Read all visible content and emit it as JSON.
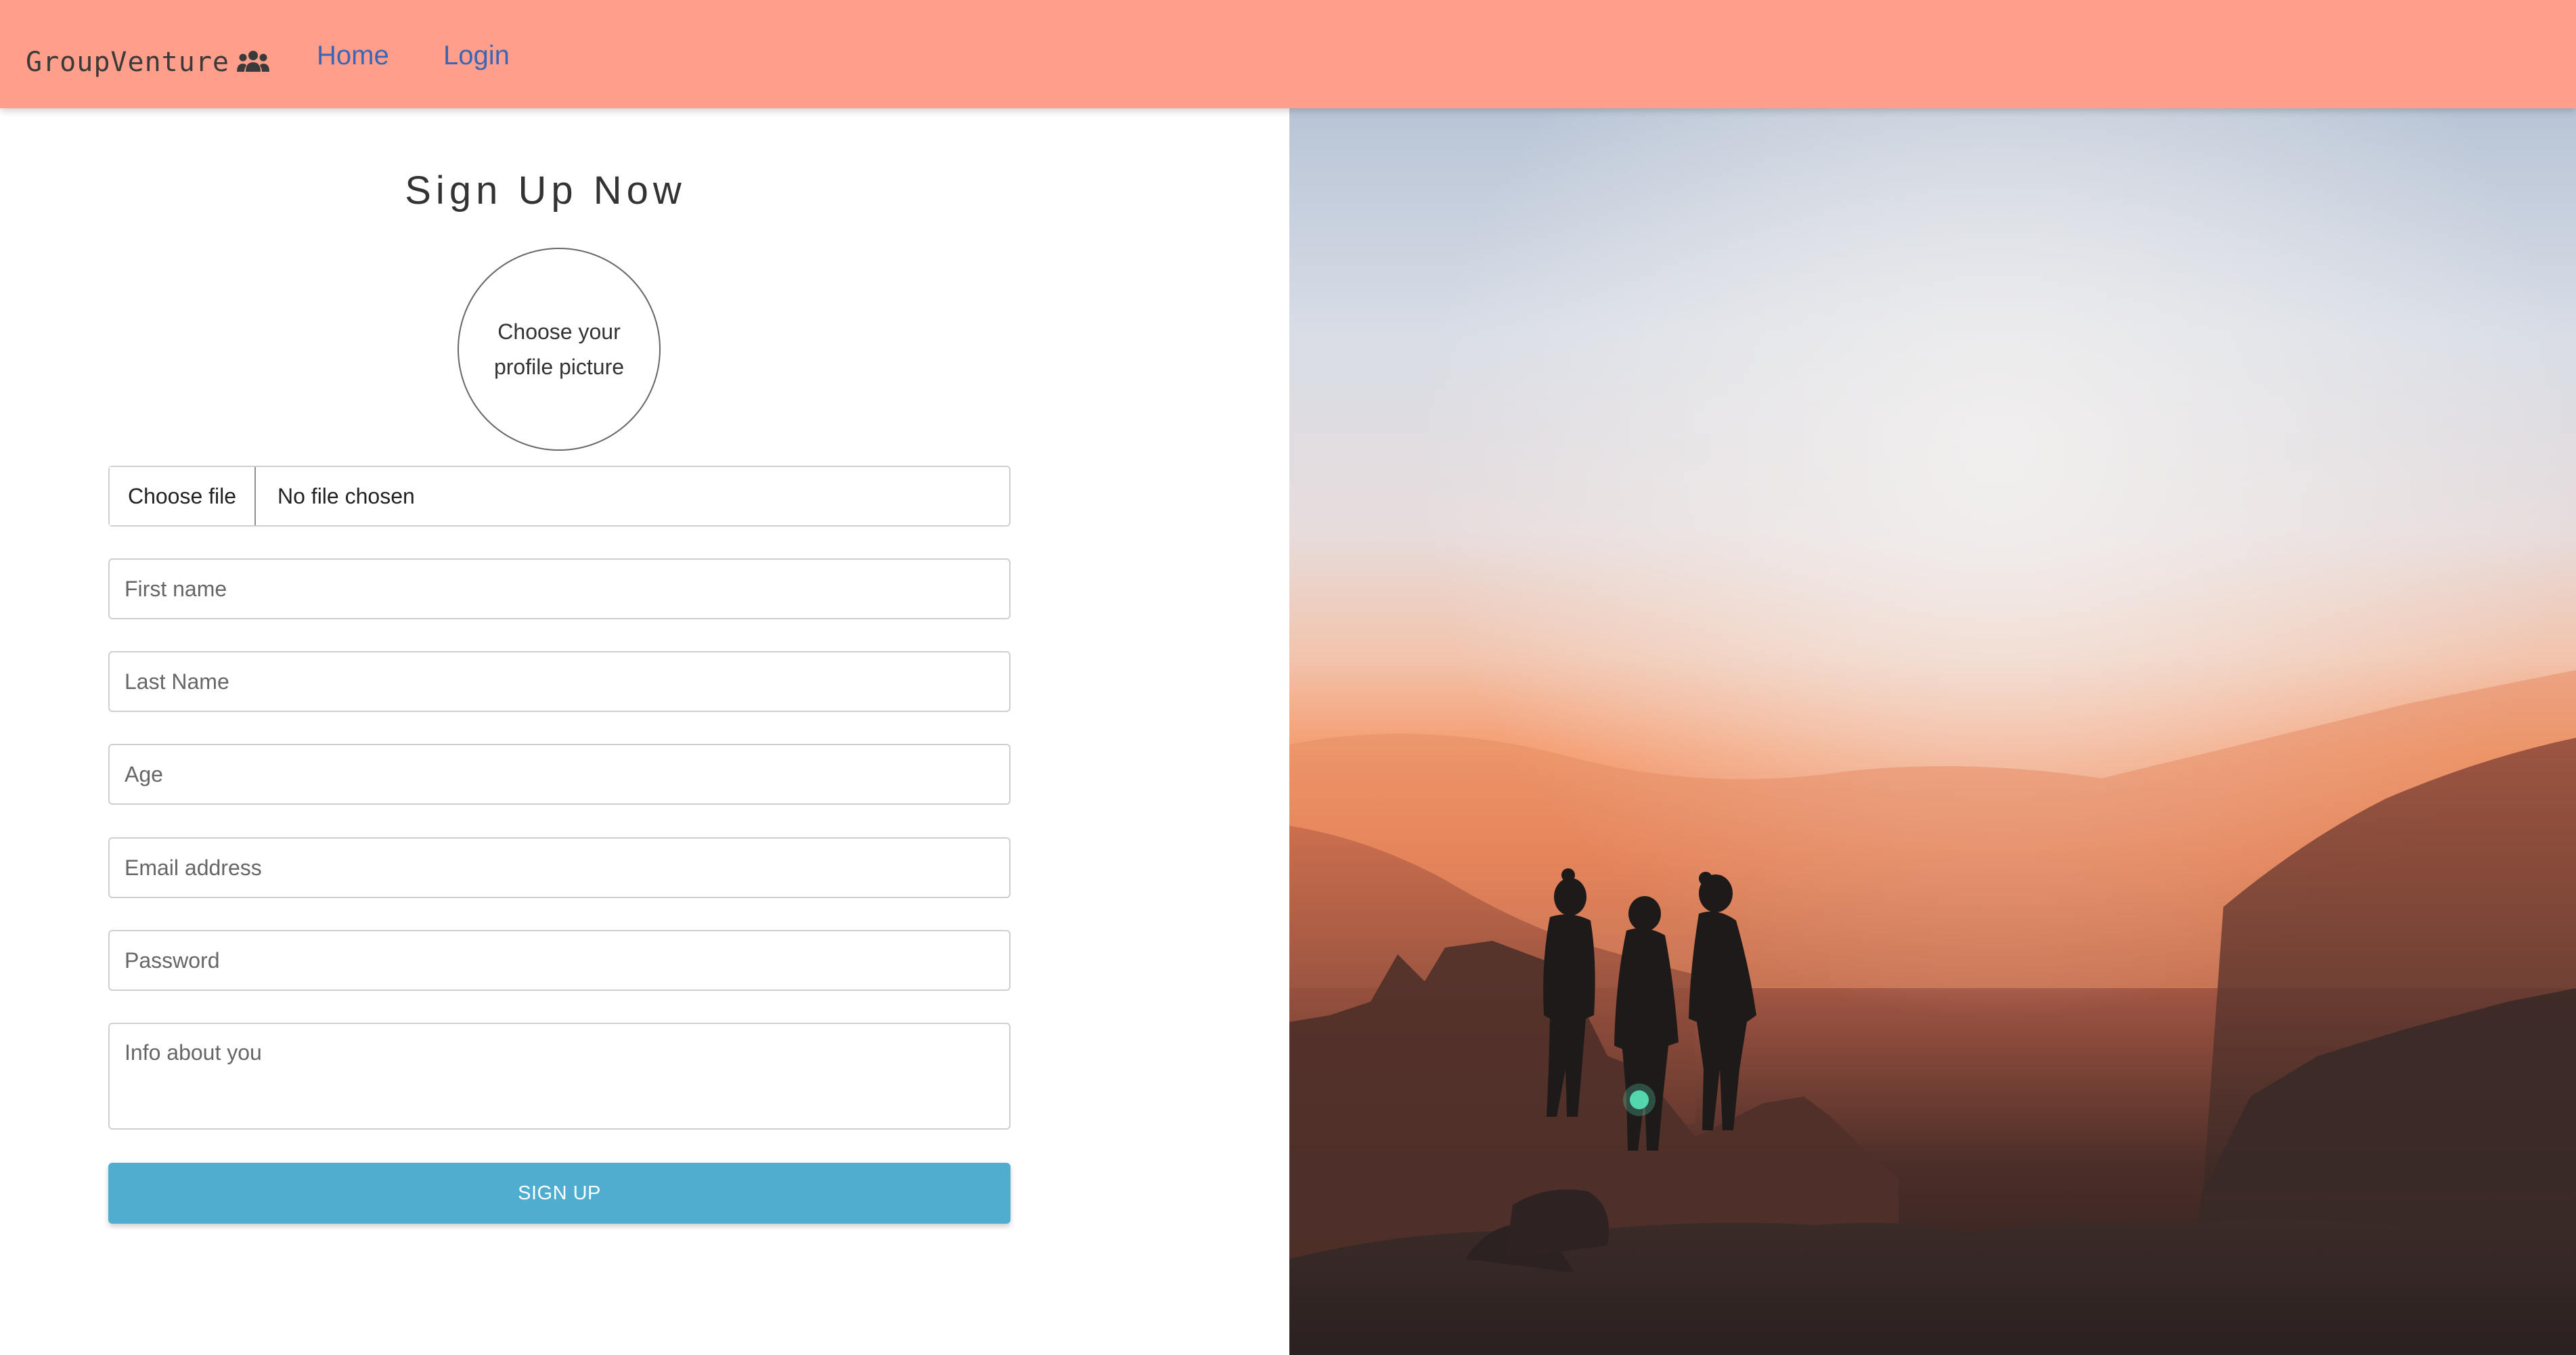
{
  "navbar": {
    "brand": "GroupVenture",
    "brand_icon": "users-group-icon",
    "links": [
      {
        "label": "Home"
      },
      {
        "label": "Login"
      }
    ]
  },
  "form": {
    "title": "Sign Up Now",
    "avatar_prompt": "Choose your profile picture",
    "file": {
      "button_label": "Choose file",
      "status": "No file chosen"
    },
    "fields": {
      "first_name": "First name",
      "last_name": "Last Name",
      "age": "Age",
      "email": "Email address",
      "password": "Password",
      "info": "Info about you"
    },
    "submit_label": "SIGN UP"
  },
  "hero": {
    "image": "sunset-mountains-three-people-silhouette"
  },
  "colors": {
    "navbar_bg": "#ff9e8a",
    "link": "#3a66b4",
    "button_bg": "#4fadcf"
  }
}
